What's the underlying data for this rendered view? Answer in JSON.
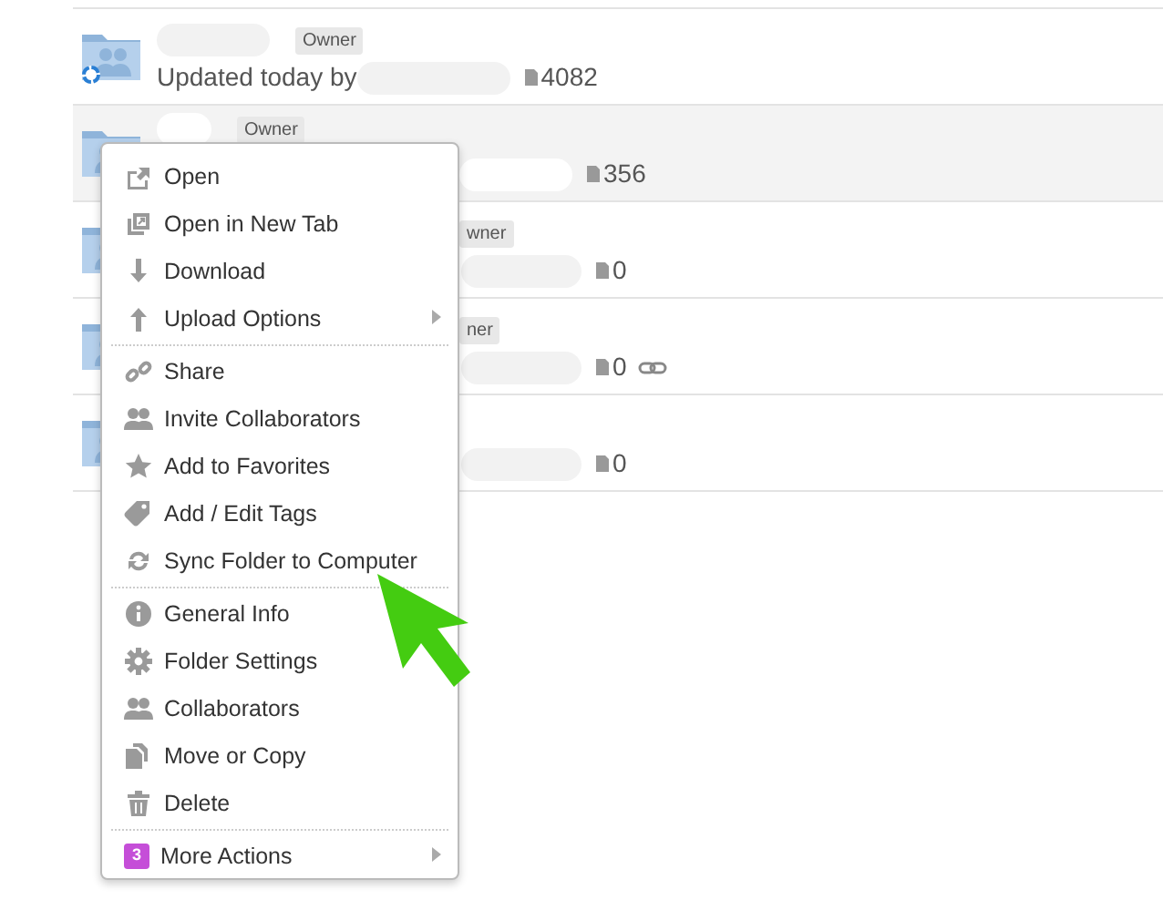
{
  "rows": [
    {
      "kind": "full",
      "selected": false,
      "sync": true,
      "badge": "Owner",
      "updated": "Updated today by",
      "count": "4082",
      "link": false
    },
    {
      "kind": "partial",
      "selected": true,
      "sync": false,
      "badge": "Owner",
      "count": "356",
      "link": false
    },
    {
      "kind": "covered",
      "selected": false,
      "sync": false,
      "badge": "wner",
      "count": "0",
      "link": false
    },
    {
      "kind": "covered",
      "selected": false,
      "sync": false,
      "badge": "ner",
      "count": "0",
      "link": true
    },
    {
      "kind": "covered",
      "selected": false,
      "sync": false,
      "count": "0",
      "link": false
    }
  ],
  "menu": {
    "sections": [
      [
        {
          "label": "Open"
        },
        {
          "label": "Open in New Tab"
        },
        {
          "label": "Download"
        },
        {
          "label": "Upload Options",
          "submenu": true
        }
      ],
      [
        {
          "label": "Share"
        },
        {
          "label": "Invite Collaborators"
        },
        {
          "label": "Add to Favorites"
        },
        {
          "label": "Add / Edit Tags"
        },
        {
          "label": "Sync Folder to Computer"
        }
      ],
      [
        {
          "label": "General Info"
        },
        {
          "label": "Folder Settings"
        },
        {
          "label": "Collaborators"
        },
        {
          "label": "Move or Copy"
        },
        {
          "label": "Delete"
        }
      ],
      [
        {
          "count": "3",
          "label": "More Actions",
          "submenu": true
        }
      ]
    ]
  }
}
